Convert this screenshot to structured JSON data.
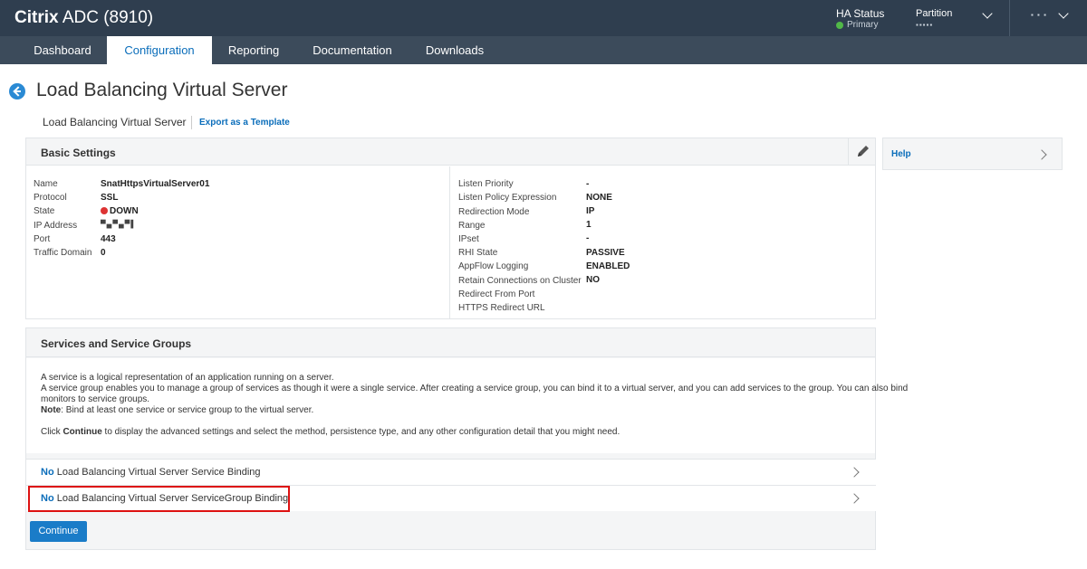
{
  "header": {
    "brand_bold": "Citrix",
    "brand_rest": "ADC (8910)",
    "ha_status_label": "HA Status",
    "ha_status_value": "Primary",
    "partition_label": "Partition",
    "partition_value": "▪▪▪▪▪"
  },
  "nav": {
    "tabs": [
      "Dashboard",
      "Configuration",
      "Reporting",
      "Documentation",
      "Downloads"
    ],
    "active": "Configuration"
  },
  "page": {
    "title": "Load Balancing Virtual Server",
    "breadcrumb": "Load Balancing Virtual Server",
    "export_link": "Export as a Template"
  },
  "basic_settings": {
    "title": "Basic Settings",
    "left": [
      {
        "label": "Name",
        "value": "SnatHttpsVirtualServer01"
      },
      {
        "label": "Protocol",
        "value": "SSL"
      },
      {
        "label": "State",
        "value": "DOWN"
      },
      {
        "label": "IP Address",
        "value": "▀▄▀▄▀▌"
      },
      {
        "label": "Port",
        "value": "443"
      },
      {
        "label": "Traffic Domain",
        "value": "0"
      }
    ],
    "right": [
      {
        "label": "Listen Priority",
        "value": "-"
      },
      {
        "label": "Listen Policy Expression",
        "value": "NONE"
      },
      {
        "label": "Redirection Mode",
        "value": "IP"
      },
      {
        "label": "Range",
        "value": "1"
      },
      {
        "label": "IPset",
        "value": "-"
      },
      {
        "label": "RHI State",
        "value": "PASSIVE"
      },
      {
        "label": "AppFlow Logging",
        "value": "ENABLED"
      },
      {
        "label": "Retain Connections on Cluster",
        "value": "NO"
      },
      {
        "label": "Redirect From Port",
        "value": ""
      },
      {
        "label": "HTTPS Redirect URL",
        "value": ""
      }
    ]
  },
  "services": {
    "title": "Services and Service Groups",
    "desc_line1": "A service is a logical representation of an application running on a server.",
    "desc_line2": "A service group enables you to manage a group of services as though it were a single service. After creating a service group, you can bind it to a virtual server, and you can add services to the group. You can also bind",
    "desc_line3": "monitors to service groups.",
    "note_label": "Note",
    "note_text": ": Bind at least one service or service group to the virtual server.",
    "click_pre": "Click ",
    "click_bold": "Continue",
    "click_post": " to display the advanced settings and select the method, persistence type, and any other configuration detail that you might need.",
    "bindings": [
      {
        "prefix": "No",
        "text": " Load Balancing Virtual Server Service Binding"
      },
      {
        "prefix": "No",
        "text": " Load Balancing Virtual Server ServiceGroup Binding"
      }
    ],
    "continue_label": "Continue"
  },
  "help": {
    "label": "Help"
  },
  "colors": {
    "topbar": "#2f3e4f",
    "nav": "#3c4b5b",
    "accent": "#0a6dba",
    "status_down": "#d33333",
    "status_primary": "#51b848"
  }
}
